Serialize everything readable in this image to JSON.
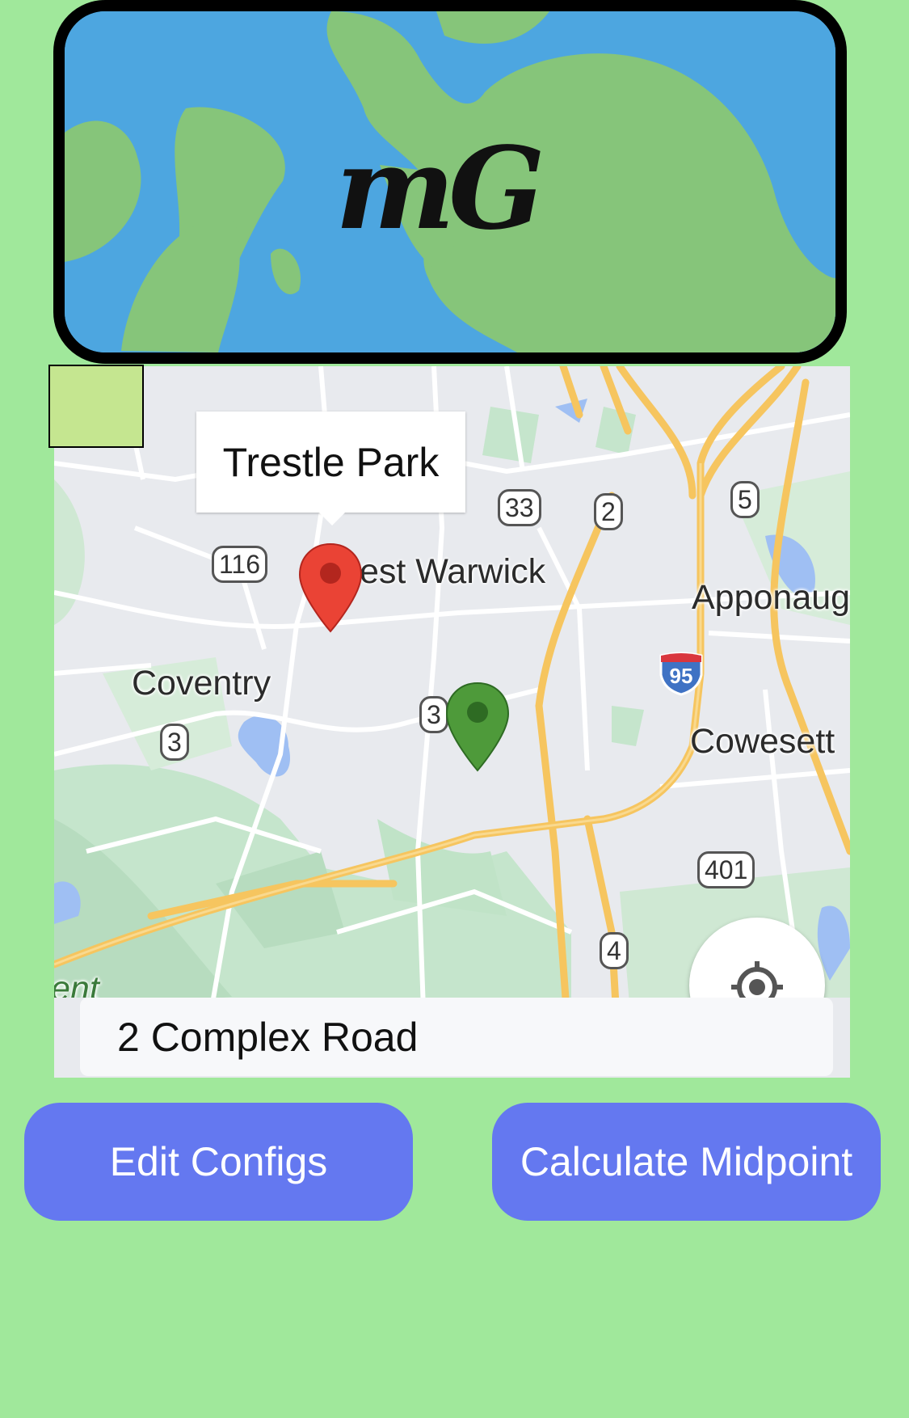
{
  "logo": {
    "text": "mG",
    "icon": "map-logo"
  },
  "map": {
    "callout_title": "Trestle Park",
    "place_labels": [
      "est Warwick",
      "Apponaug",
      "Coventry",
      "Cowesett",
      "ent"
    ],
    "route_shields": [
      "116",
      "33",
      "2",
      "5",
      "3",
      "3",
      "401",
      "4",
      "95"
    ],
    "markers": [
      "red-pin-icon",
      "green-pin-icon"
    ],
    "locate_icon": "locate-crosshair-icon"
  },
  "address": {
    "value": "2 Complex Road"
  },
  "buttons": {
    "edit_configs": "Edit Configs",
    "calculate_midpoint": "Calculate Midpoint"
  },
  "colors": {
    "background": "#a0e89b",
    "button": "#6478f0",
    "logo_water": "#4da6e0",
    "logo_land": "#86c57a"
  }
}
